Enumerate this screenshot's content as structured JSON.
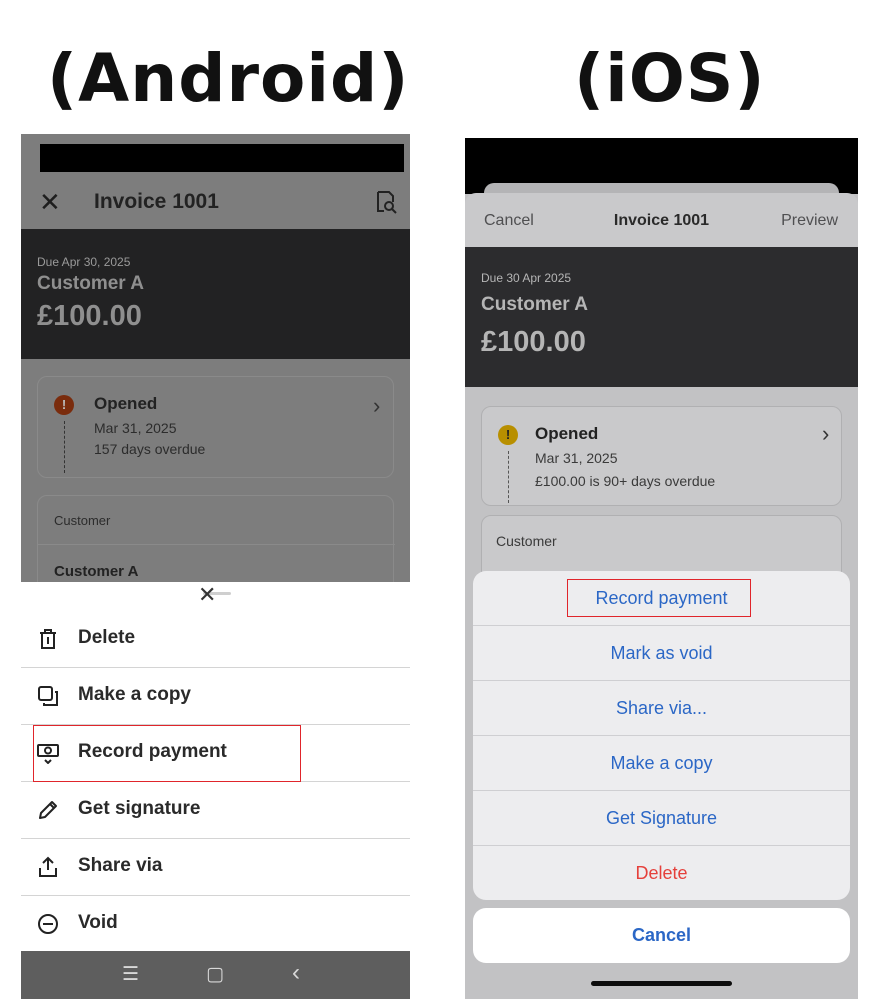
{
  "labels": {
    "android": "(Android)",
    "ios": "(iOS)"
  },
  "android": {
    "header": {
      "title": "Invoice 1001",
      "close_icon": "close-icon",
      "preview_icon": "document-search-icon"
    },
    "invoice": {
      "due": "Due Apr 30, 2025",
      "customer": "Customer A",
      "amount": "£100.00"
    },
    "status": {
      "title": "Opened",
      "date": "Mar 31, 2025",
      "detail": "157 days overdue"
    },
    "customer_card": {
      "label": "Customer",
      "value": "Customer A"
    },
    "menu": [
      {
        "label": "Delete",
        "icon": "trash-icon"
      },
      {
        "label": "Make a copy",
        "icon": "copy-icon"
      },
      {
        "label": "Record payment",
        "icon": "cash-icon"
      },
      {
        "label": "Get signature",
        "icon": "pencil-icon"
      },
      {
        "label": "Share via",
        "icon": "share-icon"
      },
      {
        "label": "Void",
        "icon": "void-icon"
      }
    ],
    "nav": {
      "recents": "☰",
      "home": "▢",
      "back": "‹"
    }
  },
  "ios": {
    "nav": {
      "cancel": "Cancel",
      "title": "Invoice 1001",
      "preview": "Preview"
    },
    "invoice": {
      "due": "Due 30 Apr 2025",
      "customer": "Customer A",
      "amount": "£100.00"
    },
    "status": {
      "title": "Opened",
      "date": "Mar 31, 2025",
      "detail": "£100.00 is 90+ days overdue"
    },
    "customer_card": {
      "label": "Customer"
    },
    "actions": [
      {
        "label": "Record payment"
      },
      {
        "label": "Mark as void"
      },
      {
        "label": "Share via..."
      },
      {
        "label": "Make a copy"
      },
      {
        "label": "Get Signature"
      },
      {
        "label": "Delete"
      }
    ],
    "cancel": "Cancel"
  },
  "colors": {
    "highlight": "#e0252b",
    "ios_action": "#2b67c6",
    "ios_destructive": "#e5403b",
    "android_status": "#7a2c0d",
    "ios_status": "#b88f00"
  }
}
